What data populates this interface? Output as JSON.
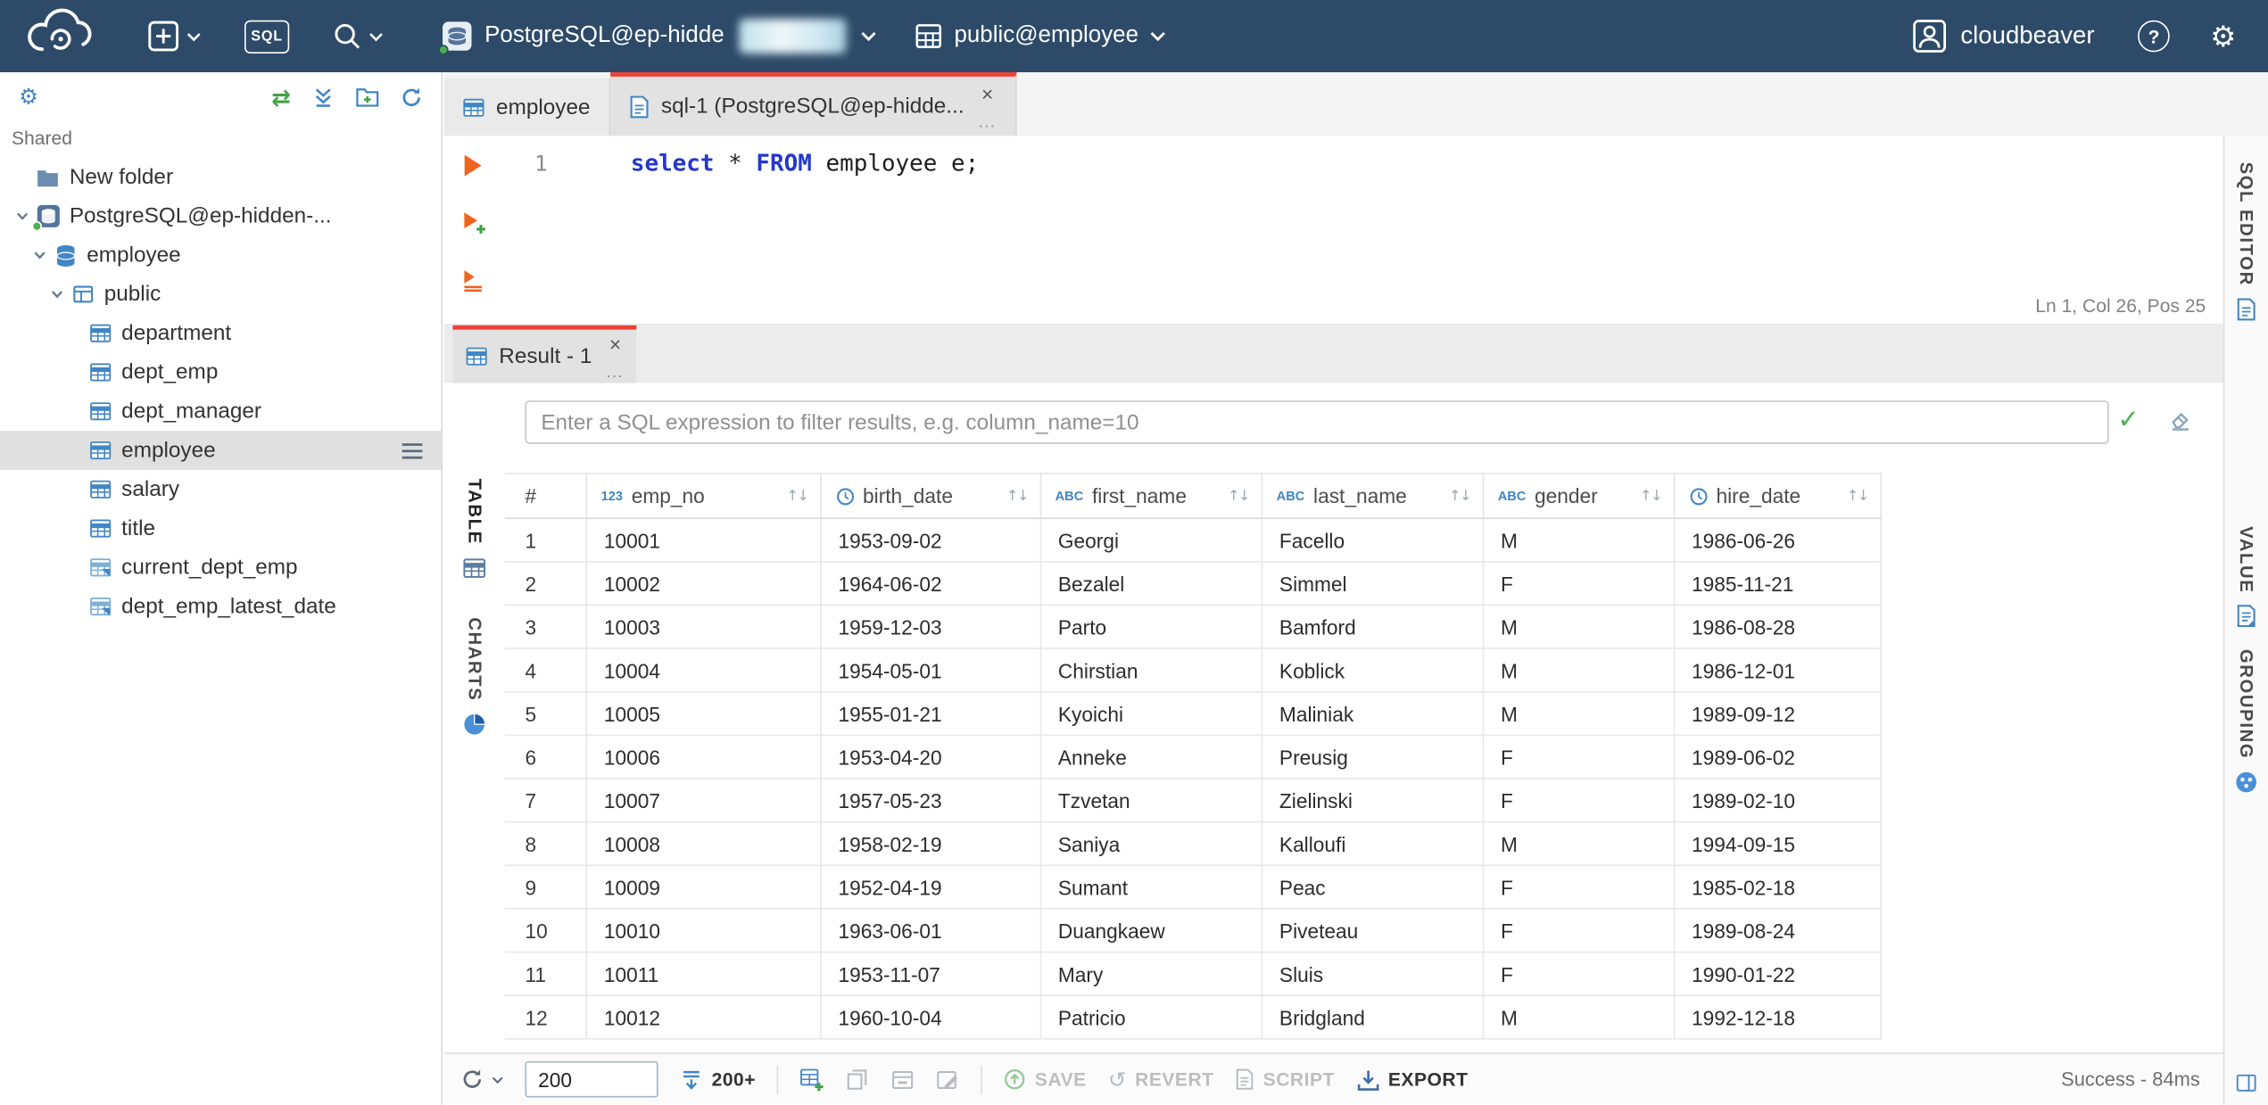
{
  "colors": {
    "header_bg": "#2d4b68",
    "accent_red": "#ef4136",
    "icon_blue": "#4186c5",
    "green": "#43a047",
    "orange": "#f0641e",
    "keyword_blue": "#2438c8"
  },
  "header": {
    "sql_button": "SQL",
    "connection_label": "PostgreSQL@ep-hidde",
    "schema_label": "public@employee",
    "user_name": "cloudbeaver",
    "help": "?"
  },
  "sidebar": {
    "section_label": "Shared",
    "tree": [
      {
        "label": "New folder",
        "icon": "folder"
      },
      {
        "label": "PostgreSQL@ep-hidden-...",
        "icon": "postgres-connection",
        "expanded": true
      },
      {
        "label": "employee",
        "icon": "database",
        "expanded": true
      },
      {
        "label": "public",
        "icon": "schema",
        "expanded": true
      },
      {
        "label": "department",
        "icon": "table"
      },
      {
        "label": "dept_emp",
        "icon": "table"
      },
      {
        "label": "dept_manager",
        "icon": "table"
      },
      {
        "label": "employee",
        "icon": "table",
        "selected": true
      },
      {
        "label": "salary",
        "icon": "table"
      },
      {
        "label": "title",
        "icon": "table"
      },
      {
        "label": "current_dept_emp",
        "icon": "view"
      },
      {
        "label": "dept_emp_latest_date",
        "icon": "view"
      }
    ]
  },
  "tabs": {
    "editor_tabs": [
      {
        "label": "employee"
      },
      {
        "label": "sql-1 (PostgreSQL@ep-hidde..."
      }
    ]
  },
  "editor": {
    "line_number": "1",
    "tokens": [
      {
        "text": "select",
        "type": "kw"
      },
      {
        "text": " * ",
        "type": "pl"
      },
      {
        "text": "FROM",
        "type": "kw"
      },
      {
        "text": " employee e;",
        "type": "pl"
      }
    ],
    "status": "Ln 1, Col 26, Pos 25",
    "side_tab": "SQL EDITOR"
  },
  "result": {
    "tab_label": "Result - 1",
    "filter_placeholder": "Enter a SQL expression to filter results, e.g. column_name=10",
    "left_tabs": {
      "table": "TABLE",
      "charts": "CHARTS"
    },
    "side_tabs": {
      "value": "VALUE",
      "grouping": "GROUPING"
    },
    "grid": {
      "row_number_header": "#",
      "columns": [
        {
          "name": "emp_no",
          "type": "123"
        },
        {
          "name": "birth_date",
          "type": "time"
        },
        {
          "name": "first_name",
          "type": "ABC"
        },
        {
          "name": "last_name",
          "type": "ABC"
        },
        {
          "name": "gender",
          "type": "ABC"
        },
        {
          "name": "hire_date",
          "type": "time"
        }
      ],
      "rows": [
        [
          "10001",
          "1953-09-02",
          "Georgi",
          "Facello",
          "M",
          "1986-06-26"
        ],
        [
          "10002",
          "1964-06-02",
          "Bezalel",
          "Simmel",
          "F",
          "1985-11-21"
        ],
        [
          "10003",
          "1959-12-03",
          "Parto",
          "Bamford",
          "M",
          "1986-08-28"
        ],
        [
          "10004",
          "1954-05-01",
          "Chirstian",
          "Koblick",
          "M",
          "1986-12-01"
        ],
        [
          "10005",
          "1955-01-21",
          "Kyoichi",
          "Maliniak",
          "M",
          "1989-09-12"
        ],
        [
          "10006",
          "1953-04-20",
          "Anneke",
          "Preusig",
          "F",
          "1989-06-02"
        ],
        [
          "10007",
          "1957-05-23",
          "Tzvetan",
          "Zielinski",
          "F",
          "1989-02-10"
        ],
        [
          "10008",
          "1958-02-19",
          "Saniya",
          "Kalloufi",
          "M",
          "1994-09-15"
        ],
        [
          "10009",
          "1952-04-19",
          "Sumant",
          "Peac",
          "F",
          "1985-02-18"
        ],
        [
          "10010",
          "1963-06-01",
          "Duangkaew",
          "Piveteau",
          "F",
          "1989-08-24"
        ],
        [
          "10011",
          "1953-11-07",
          "Mary",
          "Sluis",
          "F",
          "1990-01-22"
        ],
        [
          "10012",
          "1960-10-04",
          "Patricio",
          "Bridgland",
          "M",
          "1992-12-18"
        ]
      ]
    },
    "toolbar": {
      "row_limit": "200",
      "fetch_more_label": "200+",
      "save_label": "SAVE",
      "revert_label": "REVERT",
      "script_label": "SCRIPT",
      "export_label": "EXPORT",
      "status": "Success - 84ms"
    }
  },
  "icons": {
    "sort": "↑↓",
    "check": "✓",
    "close": "×",
    "more": "...",
    "gear": "⚙",
    "sync": "⇄",
    "revert": "↺"
  }
}
